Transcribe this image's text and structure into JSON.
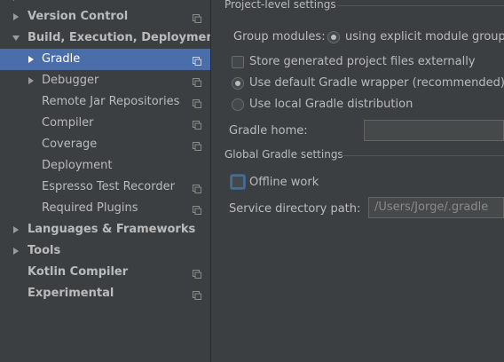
{
  "sidebar": {
    "items": [
      {
        "label": "Version Control",
        "icon": "copy-settings-icon"
      },
      {
        "label": "Build, Execution, Deployment"
      },
      {
        "label": "Gradle",
        "icon": "copy-settings-icon"
      },
      {
        "label": "Debugger",
        "icon": "copy-settings-icon"
      },
      {
        "label": "Remote Jar Repositories",
        "icon": "copy-settings-icon"
      },
      {
        "label": "Compiler",
        "icon": "copy-settings-icon"
      },
      {
        "label": "Coverage",
        "icon": "copy-settings-icon"
      },
      {
        "label": "Deployment"
      },
      {
        "label": "Espresso Test Recorder",
        "icon": "copy-settings-icon"
      },
      {
        "label": "Required Plugins",
        "icon": "copy-settings-icon"
      },
      {
        "label": "Languages & Frameworks"
      },
      {
        "label": "Tools"
      },
      {
        "label": "Kotlin Compiler",
        "icon": "copy-settings-icon"
      },
      {
        "label": "Experimental",
        "icon": "copy-settings-icon"
      }
    ],
    "selected": "Gradle",
    "selection_color": "#4a6ea9"
  },
  "project_settings": {
    "title": "Project-level settings",
    "group_modules_label": "Group modules:",
    "group_modules_option": "using explicit module groups",
    "store_externally_label": "Store generated project files externally",
    "store_externally_checked": false,
    "use_wrapper_label": "Use default Gradle wrapper (recommended)",
    "use_wrapper_selected": true,
    "use_local_label": "Use local Gradle distribution",
    "use_local_selected": false,
    "gradle_home_label": "Gradle home:",
    "gradle_home_value": ""
  },
  "global_settings": {
    "title": "Global Gradle settings",
    "offline_work_label": "Offline work",
    "offline_work_checked": false,
    "service_dir_label": "Service directory path:",
    "service_dir_value": "/Users/Jorge/.gradle"
  }
}
